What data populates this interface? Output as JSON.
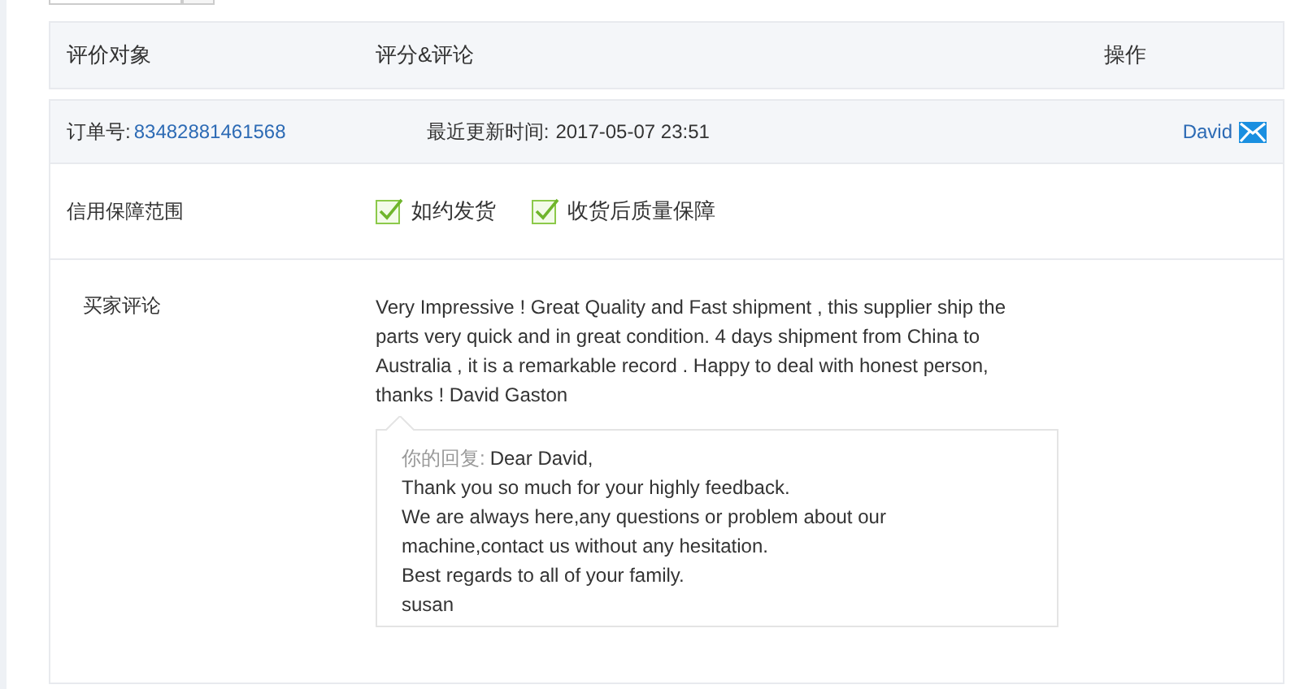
{
  "top_field": {
    "kind": "input"
  },
  "table": {
    "columns": [
      "评价对象",
      "评分&评论",
      "操作"
    ]
  },
  "order": {
    "label": "订单号:",
    "number": "83482881461568",
    "updated_label": "最近更新时间:",
    "updated": "2017-05-07 23:51",
    "buyer": "David"
  },
  "guarantee": {
    "label": "信用保障范围",
    "items": [
      {
        "label": "如约发货",
        "checked": true
      },
      {
        "label": "收货后质量保障",
        "checked": true
      }
    ]
  },
  "comment": {
    "label": "买家评论",
    "text": "Very Impressive ! Great Quality and Fast shipment , this supplier ship the parts very quick and in great condition. 4 days shipment from China to Australia , it is a remarkable record . Happy to deal with honest person, thanks ! David Gaston",
    "reply": {
      "label": "你的回复:",
      "lines": [
        "Dear David,",
        "Thank you so much for your highly feedback.",
        "We are always here,any questions or problem about our machine,contact us without any hesitation.",
        "Best regards to all of your family.",
        "susan"
      ]
    }
  }
}
